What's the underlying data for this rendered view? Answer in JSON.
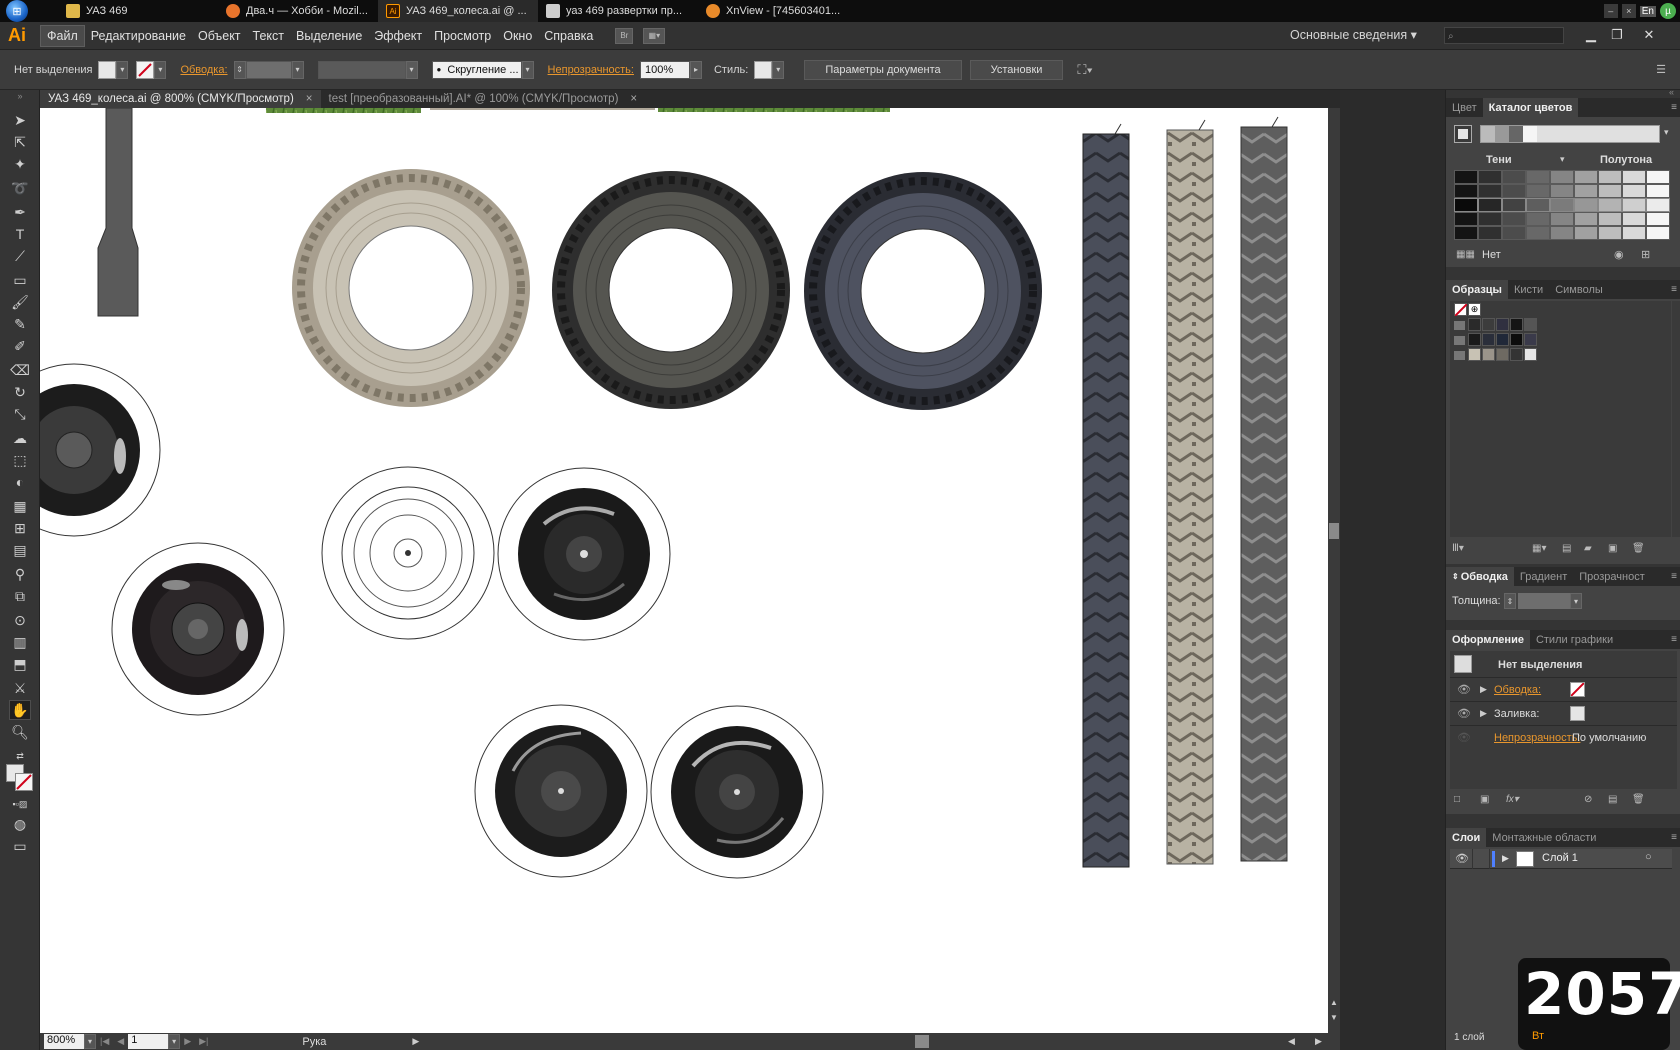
{
  "taskbar": {
    "tasks": [
      {
        "label": "УАЗ 469",
        "icon": "folder-icon",
        "color": "#e0b84a"
      },
      {
        "label": "Два.ч — Хобби - Mozil...",
        "icon": "firefox-icon",
        "color": "#e8742c"
      },
      {
        "label": "УАЗ 469_колеса.ai @ ...",
        "icon": "illustrator-icon",
        "color": "#ff9a00"
      },
      {
        "label": "уаз 469 развертки пр...",
        "icon": "inkscape-icon",
        "color": "#cccccc"
      },
      {
        "label": "XnView - [745603401...",
        "icon": "xnview-icon",
        "color": "#e88a2a"
      }
    ],
    "lang": "En"
  },
  "menubar": {
    "logo": "Ai",
    "items": [
      "Файл",
      "Редактирование",
      "Объект",
      "Текст",
      "Выделение",
      "Эффект",
      "Просмотр",
      "Окно",
      "Справка"
    ],
    "bridge_label": "Br",
    "workspace": "Основные сведения"
  },
  "controlbar": {
    "selection": "Нет выделения",
    "stroke_label": "Обводка:",
    "brush_label": "Скругление ...",
    "opacity_label": "Непрозрачность:",
    "opacity_value": "100%",
    "style_label": "Стиль:",
    "doc_params_button": "Параметры документа",
    "settings_button": "Установки"
  },
  "tabs": [
    {
      "label": "УАЗ 469_колеса.ai @ 800% (CMYK/Просмотр)",
      "active": true
    },
    {
      "label": "test [преобразованный].AI* @ 100% (CMYK/Просмотр)",
      "active": false
    }
  ],
  "statusbar": {
    "zoom": "800%",
    "page": "1",
    "tool": "Рука"
  },
  "panels": {
    "color": {
      "tabs": [
        "Цвет",
        "Каталог цветов"
      ],
      "group1": "Тени",
      "group2": "Полутона",
      "none_label": "Нет"
    },
    "swatches": {
      "tabs": [
        "Образцы",
        "Кисти",
        "Символы"
      ]
    },
    "stroke": {
      "tabs": [
        "Обводка",
        "Градиент",
        "Прозрачност"
      ],
      "weight_label": "Толщина:"
    },
    "appearance": {
      "tabs": [
        "Оформление",
        "Стили графики"
      ],
      "title": "Нет выделения",
      "stroke_label": "Обводка:",
      "fill_label": "Заливка:",
      "opacity_label": "Непрозрачность:",
      "opacity_value": "По умолчанию"
    },
    "layers": {
      "tabs": [
        "Слои",
        "Монтажные области"
      ],
      "layer_name": "Слой 1",
      "footer": "1 слой"
    }
  },
  "clock": {
    "time": "2057",
    "day": "Вт"
  }
}
